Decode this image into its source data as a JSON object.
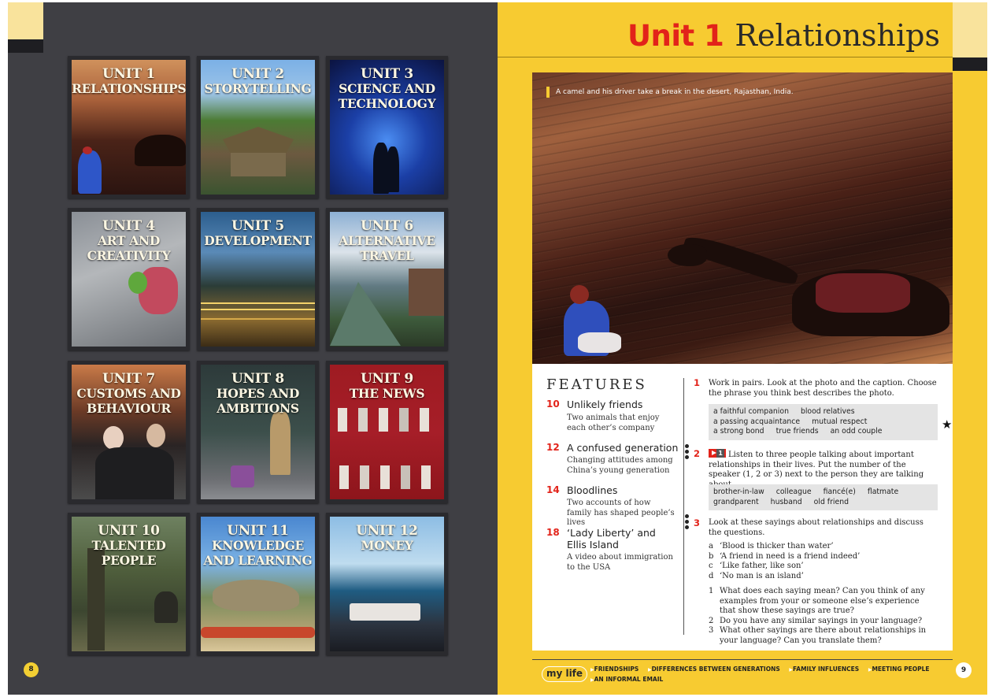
{
  "left_page": {
    "page_number": "8",
    "units": [
      {
        "number": "UNIT 1",
        "title": "RELATIONSHIPS"
      },
      {
        "number": "UNIT 2",
        "title": "STORYTELLING"
      },
      {
        "number": "UNIT 3",
        "title": "SCIENCE AND TECHNOLOGY"
      },
      {
        "number": "UNIT 4",
        "title": "ART AND CREATIVITY"
      },
      {
        "number": "UNIT 5",
        "title": "DEVELOPMENT"
      },
      {
        "number": "UNIT 6",
        "title": "ALTERNATIVE TRAVEL"
      },
      {
        "number": "UNIT 7",
        "title": "CUSTOMS AND BEHAVIOUR"
      },
      {
        "number": "UNIT 8",
        "title": "HOPES AND AMBITIONS"
      },
      {
        "number": "UNIT 9",
        "title": "THE NEWS"
      },
      {
        "number": "UNIT 10",
        "title": "TALENTED PEOPLE"
      },
      {
        "number": "UNIT 11",
        "title": "KNOWLEDGE AND LEARNING"
      },
      {
        "number": "UNIT 12",
        "title": "MONEY"
      }
    ]
  },
  "right_page": {
    "page_number": "9",
    "unit_number": "Unit 1",
    "unit_name": "Relationships",
    "photo_caption": "A camel and his driver take a break in the desert, Rajasthan, India.",
    "features": {
      "heading": "FEATURES",
      "items": [
        {
          "page": "10",
          "title": "Unlikely friends",
          "desc": "Two animals that enjoy each other’s company"
        },
        {
          "page": "12",
          "title": "A confused generation",
          "desc": "Changing attitudes among China’s young generation"
        },
        {
          "page": "14",
          "title": "Bloodlines",
          "desc": "Two accounts of how family has shaped people’s lives"
        },
        {
          "page": "18",
          "title": "‘Lady Liberty’ and Ellis Island",
          "desc": "A video about immigration to the USA"
        }
      ]
    },
    "activities": {
      "a1": {
        "num": "1",
        "text": "Work in pairs. Look at the photo and the caption. Choose the phrase you think best describes the photo.",
        "vocab": [
          [
            "a faithful companion",
            "blood relatives"
          ],
          [
            "a passing acquaintance",
            "mutual respect"
          ],
          [
            "a strong bond",
            "true friends",
            "an odd couple"
          ]
        ]
      },
      "a2": {
        "num": "2",
        "video_label": "1",
        "text": "Listen to three people talking about important relationships in their lives. Put the number of the speaker (1, 2 or 3) next to the person they are talking about.",
        "vocab": [
          [
            "brother-in-law",
            "colleague",
            "fiancé(e)",
            "flatmate"
          ],
          [
            "grandparent",
            "husband",
            "old friend"
          ]
        ]
      },
      "a3": {
        "num": "3",
        "text": "Look at these sayings about relationships and discuss the questions.",
        "sayings": [
          {
            "label": "a",
            "text": "‘Blood is thicker than water’"
          },
          {
            "label": "b",
            "text": "‘A friend in need is a friend indeed’"
          },
          {
            "label": "c",
            "text": "‘Like father, like son’"
          },
          {
            "label": "d",
            "text": "‘No man is an island’"
          }
        ],
        "questions": [
          {
            "label": "1",
            "text": "What does each saying mean? Can you think of any examples from your or someone else’s experience that show these sayings are true?"
          },
          {
            "label": "2",
            "text": "Do you have any similar sayings in your language?"
          },
          {
            "label": "3",
            "text": "What other sayings are there about relationships in your language? Can you translate them?"
          }
        ]
      }
    },
    "my_life": {
      "badge": "my life",
      "topics": [
        "FRIENDSHIPS",
        "DIFFERENCES BETWEEN GENERATIONS",
        "FAMILY INFLUENCES",
        "MEETING PEOPLE",
        "AN INFORMAL EMAIL"
      ]
    },
    "star_icon": "star-icon"
  },
  "colors": {
    "accent_red": "#e2231a",
    "page_yellow": "#f7cb31",
    "left_page_bg": "#3f3f44"
  }
}
